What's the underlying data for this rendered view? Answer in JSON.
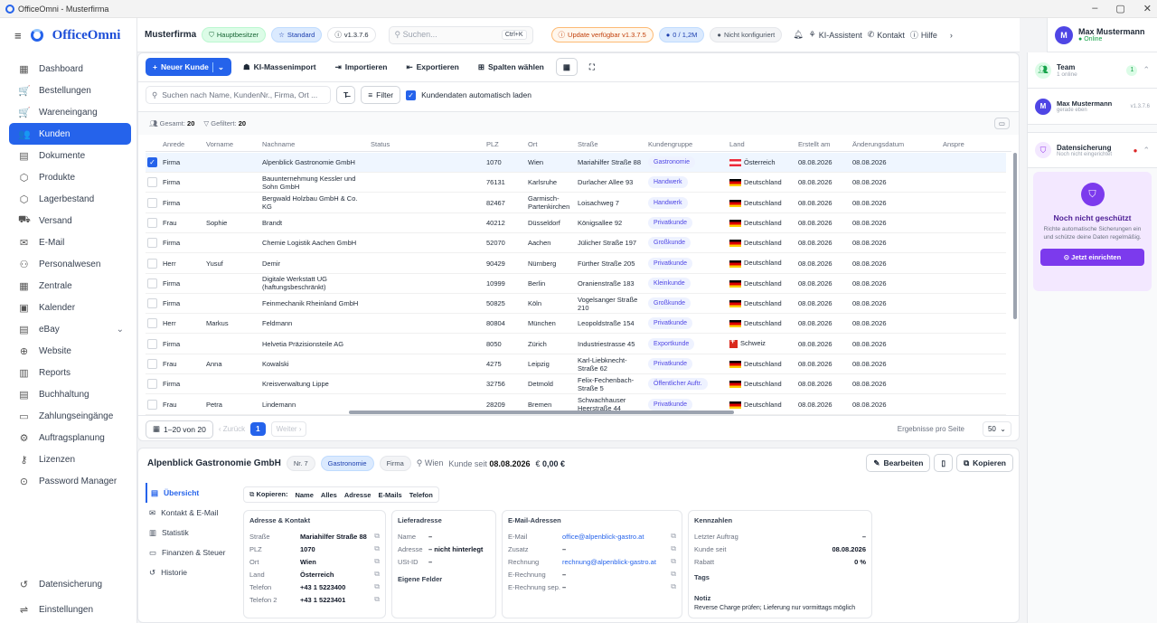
{
  "window": {
    "title": "OfficeOmni - Musterfirma",
    "min": "–",
    "max": "▢",
    "close": "✕"
  },
  "brand": {
    "name": "OfficeOmni"
  },
  "sidebar": {
    "items": [
      {
        "label": "Dashboard",
        "icon": "▦"
      },
      {
        "label": "Bestellungen",
        "icon": "🛒"
      },
      {
        "label": "Wareneingang",
        "icon": "🛒"
      },
      {
        "label": "Kunden",
        "icon": "👥"
      },
      {
        "label": "Dokumente",
        "icon": "▤"
      },
      {
        "label": "Produkte",
        "icon": "⬡"
      },
      {
        "label": "Lagerbestand",
        "icon": "⬡"
      },
      {
        "label": "Versand",
        "icon": "⛟"
      },
      {
        "label": "E-Mail",
        "icon": "✉"
      },
      {
        "label": "Personalwesen",
        "icon": "⚇"
      },
      {
        "label": "Zentrale",
        "icon": "▦"
      },
      {
        "label": "Kalender",
        "icon": "▣"
      },
      {
        "label": "eBay",
        "icon": "▤",
        "chevron": "⌄"
      },
      {
        "label": "Website",
        "icon": "⊕"
      },
      {
        "label": "Reports",
        "icon": "▥"
      },
      {
        "label": "Buchhaltung",
        "icon": "▤"
      },
      {
        "label": "Zahlungseingänge",
        "icon": "▭"
      },
      {
        "label": "Auftragsplanung",
        "icon": "⚙"
      },
      {
        "label": "Lizenzen",
        "icon": "⚷"
      },
      {
        "label": "Password Manager",
        "icon": "⊙"
      }
    ],
    "bottom": [
      {
        "label": "Datensicherung",
        "icon": "↺"
      },
      {
        "label": "Einstellungen",
        "icon": "⇌"
      }
    ]
  },
  "topbar": {
    "company": "Musterfirma",
    "role": "Hauptbesitzer",
    "plan": "Standard",
    "version": "v1.3.7.6",
    "search_placeholder": "Suchen...",
    "shortcut": "Ctrl+K",
    "update": "Update verfügbar v1.3.7.5",
    "storage": "0 / 1,2M",
    "config": "Nicht konfiguriert",
    "ai": "KI-Assistent",
    "contact": "Kontakt",
    "help": "Hilfe"
  },
  "user": {
    "initial": "M",
    "name": "Max Mustermann",
    "status": "Online"
  },
  "toolbar": {
    "new": "Neuer Kunde",
    "ai_import": "KI-Massenimport",
    "import": "Importieren",
    "export": "Exportieren",
    "columns": "Spalten wählen"
  },
  "filterbar": {
    "search_placeholder": "Suchen nach Name, KundenNr., Firma, Ort ...",
    "filter": "Filter",
    "autoload": "Kundendaten automatisch laden"
  },
  "stats": {
    "total_label": "Gesamt:",
    "total": "20",
    "filtered_label": "Gefiltert:",
    "filtered": "20"
  },
  "columns": [
    "Anrede",
    "Vorname",
    "Nachname",
    "Status",
    "PLZ",
    "Ort",
    "Straße",
    "Kundengruppe",
    "Land",
    "Erstellt am",
    "Änderungsdatum",
    "Anspre"
  ],
  "rows": [
    {
      "anrede": "Firma",
      "vorname": "",
      "nachname": "Alpenblick Gastronomie GmbH",
      "plz": "1070",
      "ort": "Wien",
      "strasse": "Mariahilfer Straße 88",
      "gruppe": "Gastronomie",
      "land": "Österreich",
      "flag": "at",
      "erstellt": "08.08.2026",
      "geaendert": "08.08.2026",
      "selected": true
    },
    {
      "anrede": "Firma",
      "vorname": "",
      "nachname": "Bauunternehmung Kessler und Sohn GmbH",
      "plz": "76131",
      "ort": "Karlsruhe",
      "strasse": "Durlacher Allee 93",
      "gruppe": "Handwerk",
      "land": "Deutschland",
      "flag": "de",
      "erstellt": "08.08.2026",
      "geaendert": "08.08.2026"
    },
    {
      "anrede": "Firma",
      "vorname": "",
      "nachname": "Bergwald Holzbau GmbH & Co. KG",
      "plz": "82467",
      "ort": "Garmisch-Partenkirchen",
      "strasse": "Loisachweg 7",
      "gruppe": "Handwerk",
      "land": "Deutschland",
      "flag": "de",
      "erstellt": "08.08.2026",
      "geaendert": "08.08.2026"
    },
    {
      "anrede": "Frau",
      "vorname": "Sophie",
      "nachname": "Brandt",
      "plz": "40212",
      "ort": "Düsseldorf",
      "strasse": "Königsallee 92",
      "gruppe": "Privatkunde",
      "land": "Deutschland",
      "flag": "de",
      "erstellt": "08.08.2026",
      "geaendert": "08.08.2026"
    },
    {
      "anrede": "Firma",
      "vorname": "",
      "nachname": "Chemie Logistik Aachen GmbH",
      "plz": "52070",
      "ort": "Aachen",
      "strasse": "Jülicher Straße 197",
      "gruppe": "Großkunde",
      "land": "Deutschland",
      "flag": "de",
      "erstellt": "08.08.2026",
      "geaendert": "08.08.2026"
    },
    {
      "anrede": "Herr",
      "vorname": "Yusuf",
      "nachname": "Demir",
      "plz": "90429",
      "ort": "Nürnberg",
      "strasse": "Fürther Straße 205",
      "gruppe": "Privatkunde",
      "land": "Deutschland",
      "flag": "de",
      "erstellt": "08.08.2026",
      "geaendert": "08.08.2026"
    },
    {
      "anrede": "Firma",
      "vorname": "",
      "nachname": "Digitale Werkstatt UG (haftungsbeschränkt)",
      "plz": "10999",
      "ort": "Berlin",
      "strasse": "Oranienstraße 183",
      "gruppe": "Kleinkunde",
      "land": "Deutschland",
      "flag": "de",
      "erstellt": "08.08.2026",
      "geaendert": "08.08.2026"
    },
    {
      "anrede": "Firma",
      "vorname": "",
      "nachname": "Feinmechanik Rheinland GmbH",
      "plz": "50825",
      "ort": "Köln",
      "strasse": "Vogelsanger Straße 210",
      "gruppe": "Großkunde",
      "land": "Deutschland",
      "flag": "de",
      "erstellt": "08.08.2026",
      "geaendert": "08.08.2026"
    },
    {
      "anrede": "Herr",
      "vorname": "Markus",
      "nachname": "Feldmann",
      "plz": "80804",
      "ort": "München",
      "strasse": "Leopoldstraße 154",
      "gruppe": "Privatkunde",
      "land": "Deutschland",
      "flag": "de",
      "erstellt": "08.08.2026",
      "geaendert": "08.08.2026"
    },
    {
      "anrede": "Firma",
      "vorname": "",
      "nachname": "Helvetia Präzisionsteile AG",
      "plz": "8050",
      "ort": "Zürich",
      "strasse": "Industriestrasse 45",
      "gruppe": "Exportkunde",
      "land": "Schweiz",
      "flag": "ch",
      "erstellt": "08.08.2026",
      "geaendert": "08.08.2026"
    },
    {
      "anrede": "Frau",
      "vorname": "Anna",
      "nachname": "Kowalski",
      "plz": "4275",
      "ort": "Leipzig",
      "strasse": "Karl-Liebknecht-Straße 62",
      "gruppe": "Privatkunde",
      "land": "Deutschland",
      "flag": "de",
      "erstellt": "08.08.2026",
      "geaendert": "08.08.2026"
    },
    {
      "anrede": "Firma",
      "vorname": "",
      "nachname": "Kreisverwaltung Lippe",
      "plz": "32756",
      "ort": "Detmold",
      "strasse": "Felix-Fechenbach-Straße 5",
      "gruppe": "Öffentlicher Auftr.",
      "land": "Deutschland",
      "flag": "de",
      "erstellt": "08.08.2026",
      "geaendert": "08.08.2026"
    },
    {
      "anrede": "Frau",
      "vorname": "Petra",
      "nachname": "Lindemann",
      "plz": "28209",
      "ort": "Bremen",
      "strasse": "Schwachhauser Heerstraße 44",
      "gruppe": "Privatkunde",
      "land": "Deutschland",
      "flag": "de",
      "erstellt": "08.08.2026",
      "geaendert": "08.08.2026"
    }
  ],
  "pagination": {
    "range": "1–20 von 20",
    "prev": "Zurück",
    "page": "1",
    "next": "Weiter",
    "per_page_label": "Ergebnisse pro Seite",
    "per_page": "50"
  },
  "detail": {
    "name": "Alpenblick Gastronomie GmbH",
    "nr": "Nr. 7",
    "group": "Gastronomie",
    "type": "Firma",
    "city": "Wien",
    "since_label": "Kunde seit",
    "since": "08.08.2026",
    "balance": "0,00 €",
    "edit": "Bearbeiten",
    "copy": "Kopieren",
    "tabs": [
      "Übersicht",
      "Kontakt & E-Mail",
      "Statistik",
      "Finanzen & Steuer",
      "Historie"
    ],
    "copybar": {
      "label": "Kopieren:",
      "items": [
        "Name",
        "Alles",
        "Adresse",
        "E-Mails",
        "Telefon"
      ]
    },
    "address": {
      "title": "Adresse & Kontakt",
      "rows": [
        {
          "k": "Straße",
          "v": "Mariahilfer Straße 88"
        },
        {
          "k": "PLZ",
          "v": "1070"
        },
        {
          "k": "Ort",
          "v": "Wien"
        },
        {
          "k": "Land",
          "v": "Österreich"
        },
        {
          "k": "Telefon",
          "v": "+43 1 5223400"
        },
        {
          "k": "Telefon 2",
          "v": "+43 1 5223401"
        }
      ]
    },
    "delivery": {
      "title": "Lieferadresse",
      "rows": [
        {
          "k": "Name",
          "v": "–"
        },
        {
          "k": "Adresse",
          "v": "– nicht hinterlegt"
        },
        {
          "k": "USt-ID",
          "v": "–"
        }
      ],
      "custom": "Eigene Felder"
    },
    "emails": {
      "title": "E-Mail-Adressen",
      "rows": [
        {
          "k": "E-Mail",
          "v": "office@alpenblick-gastro.at"
        },
        {
          "k": "Zusatz",
          "v": "–"
        },
        {
          "k": "Rechnung",
          "v": "rechnung@alpenblick-gastro.at"
        },
        {
          "k": "E-Rechnung",
          "v": "–"
        },
        {
          "k": "E-Rechnung sep.",
          "v": "–"
        }
      ]
    },
    "kpis": {
      "title": "Kennzahlen",
      "rows": [
        {
          "k": "Letzter Auftrag",
          "v": "–"
        },
        {
          "k": "Kunde seit",
          "v": "08.08.2026"
        },
        {
          "k": "Rabatt",
          "v": "0 %"
        }
      ],
      "tags": "Tags",
      "notes_label": "Notiz",
      "notes": "Reverse Charge prüfen; Lieferung nur vormittags möglich"
    }
  },
  "rightpanel": {
    "team": "Team",
    "team_sub": "1 online",
    "team_count": "1",
    "member": "Max Mustermann",
    "member_sub": "gerade eben",
    "member_ver": "v1.3.7.6",
    "backup": "Datensicherung",
    "backup_sub": "Noch nicht eingerichtet",
    "protect_title": "Noch nicht geschützt",
    "protect_text": "Richte automatische Sicherungen ein und schütze deine Daten regelmäßig.",
    "protect_btn": "Jetzt einrichten"
  }
}
